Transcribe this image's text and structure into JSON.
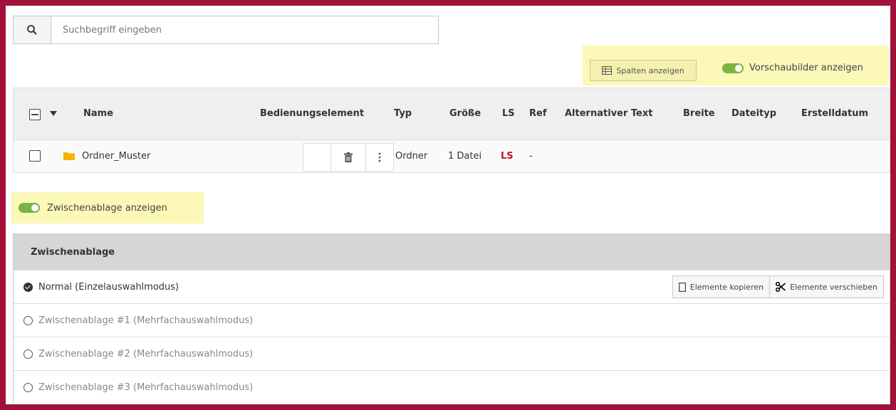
{
  "search": {
    "placeholder": "Suchbegriff eingeben",
    "icon": "search-icon"
  },
  "toolbar": {
    "columns_button": "Spalten anzeigen",
    "preview_toggle": "Vorschaubilder anzeigen",
    "preview_on": true
  },
  "table": {
    "columns": [
      "Name",
      "Bedienungselement",
      "Typ",
      "Größe",
      "LS",
      "Ref",
      "Alternativer Text",
      "Breite",
      "Dateityp",
      "Erstelldatum"
    ],
    "rows": [
      {
        "name": "Ordner_Muster",
        "type": "Ordner",
        "size": "1 Datei",
        "ls": "LS",
        "ref": "-"
      }
    ]
  },
  "clipboard_toggle": {
    "label": "Zwischenablage anzeigen",
    "on": true
  },
  "clipboard": {
    "title": "Zwischenablage",
    "modes": [
      {
        "label": "Normal (Einzelauswahlmodus)",
        "selected": true
      },
      {
        "label": "Zwischenablage #1 (Mehrfachauswahlmodus)",
        "selected": false
      },
      {
        "label": "Zwischenablage #2 (Mehrfachauswahlmodus)",
        "selected": false
      },
      {
        "label": "Zwischenablage #3 (Mehrfachauswahlmodus)",
        "selected": false
      }
    ],
    "copy_button": "Elemente kopieren",
    "move_button": "Elemente verschieben"
  },
  "colors": {
    "frame": "#a0123a",
    "toggle": "#7cb342",
    "highlight": "#fbf8b8",
    "ls_red": "#c8102e"
  }
}
